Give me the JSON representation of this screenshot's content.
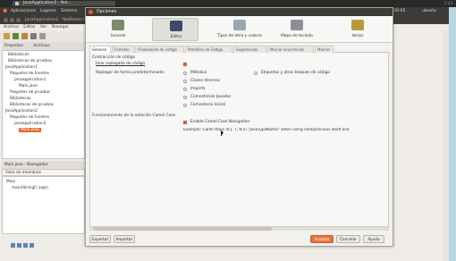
{
  "browser": {
    "tab": "JavaApplication2 - Net...",
    "clock": "2:43"
  },
  "panel": {
    "menus": [
      "Aplicaciones",
      "Lugares",
      "Sistema"
    ],
    "status_right": "lun 1 de may, 20:05",
    "user": "ubuntu"
  },
  "netbeans": {
    "title": "JavaApplication2 - NetBeans IDE 8.0.1",
    "menu": [
      "Archivo",
      "Editar",
      "Ver",
      "Navegar"
    ],
    "tabs": [
      "Proyectos",
      "Archivos"
    ],
    "tree": [
      "Bibliotecas",
      "Bibliotecas de pruebas",
      "JavaApplication1",
      "Paquetes de fuentes",
      "javaapplication1",
      "Main.java",
      "Paquetes de pruebas",
      "Bibliotecas",
      "Bibliotecas de pruebas",
      "JavaApplication2",
      "Paquetes de fuentes",
      "javaapplication2",
      "Main.java"
    ],
    "navigator_tab": "Main.java - Navegador",
    "navigator_filter": "Vista de miembros",
    "navigator_items": [
      "Main",
      "main(String[] args)"
    ]
  },
  "dialog": {
    "title": "Opciones",
    "categories": [
      {
        "label": "General",
        "icon": "general-icon",
        "color": "#7a8a6a"
      },
      {
        "label": "Editor",
        "icon": "editor-icon",
        "color": "#3e4a66"
      },
      {
        "label": "Tipos de letra y colores",
        "icon": "fonts-colors-icon",
        "color": "#9aa6b2"
      },
      {
        "label": "Mapa de teclado",
        "icon": "keymap-icon",
        "color": "#8c9096"
      },
      {
        "label": "Varios",
        "icon": "misc-icon",
        "color": "#b8983c"
      }
    ],
    "subtabs": [
      "General",
      "Formato",
      "Finalización de código",
      "Plantillas de Código",
      "Sugerencias",
      "Marcar ocurrencias",
      "Macros"
    ],
    "folding_header": "Contracción de código",
    "use_folding": "Usar replegado de código",
    "collapse_label": "Replegar de forma predeterminada:",
    "collapse_options": [
      "Métodos",
      "Clases Internas",
      "Imports",
      "Comentarios Javadoc",
      "Comentario Inicial"
    ],
    "tags_option": "Etiquetas y otros bloques de código",
    "camel_header": "Funcionamiento de la notación Camel Case",
    "camel_option": "Enable Camel Case Navigation",
    "camel_example": "Example: Caret stops at J, T, N in \"JavaTypeName\" when using next/previous word acti",
    "buttons": {
      "export": "Exportar",
      "import": "Importar",
      "accept": "Aceptar",
      "cancel": "Cancelar",
      "help": "Ayuda"
    }
  },
  "accent": "#e46b2e"
}
